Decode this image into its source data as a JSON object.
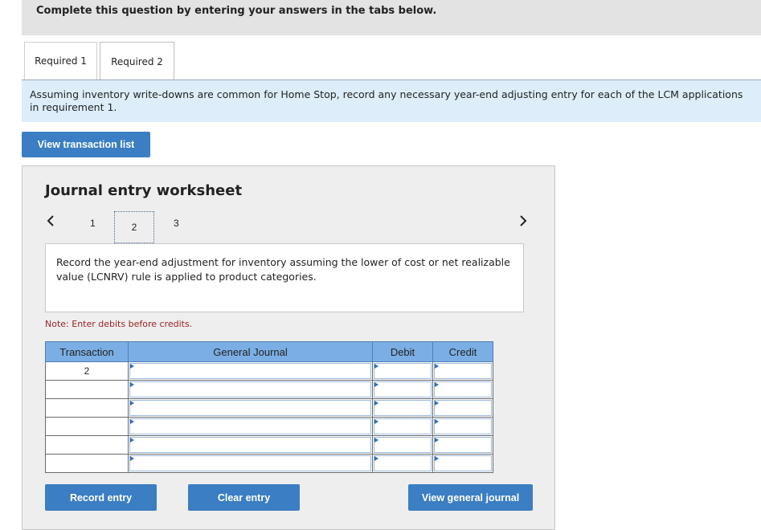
{
  "header": {
    "instruction": "Complete this question by entering your answers in the tabs below."
  },
  "tabs": [
    {
      "label": "Required 1"
    },
    {
      "label": "Required 2"
    }
  ],
  "instruction_text": "Assuming inventory write-downs are common for Home Stop, record any necessary year-end adjusting entry for each of the LCM applications in requirement 1.",
  "buttons": {
    "view_transaction_list": "View transaction list",
    "record_entry": "Record entry",
    "clear_entry": "Clear entry",
    "view_general_journal": "View general journal"
  },
  "worksheet": {
    "title": "Journal entry worksheet",
    "prev_icon": "chevron-left-icon",
    "next_icon": "chevron-right-icon",
    "pages": [
      "1",
      "2",
      "3"
    ],
    "current_page": "2",
    "description": "Record the year-end adjustment for inventory assuming the lower of cost or net realizable value (LCNRV) rule is applied to product categories.",
    "note": "Note: Enter debits before credits.",
    "columns": {
      "transaction": "Transaction",
      "general_journal": "General Journal",
      "debit": "Debit",
      "credit": "Credit"
    },
    "rows": [
      {
        "transaction": "2"
      },
      {
        "transaction": ""
      },
      {
        "transaction": ""
      },
      {
        "transaction": ""
      },
      {
        "transaction": ""
      },
      {
        "transaction": ""
      }
    ]
  },
  "colors": {
    "button_blue": "#3b7ec3",
    "table_header": "#7baee4",
    "instruction_bg": "#ddeefa",
    "note_red": "#9c2424"
  }
}
